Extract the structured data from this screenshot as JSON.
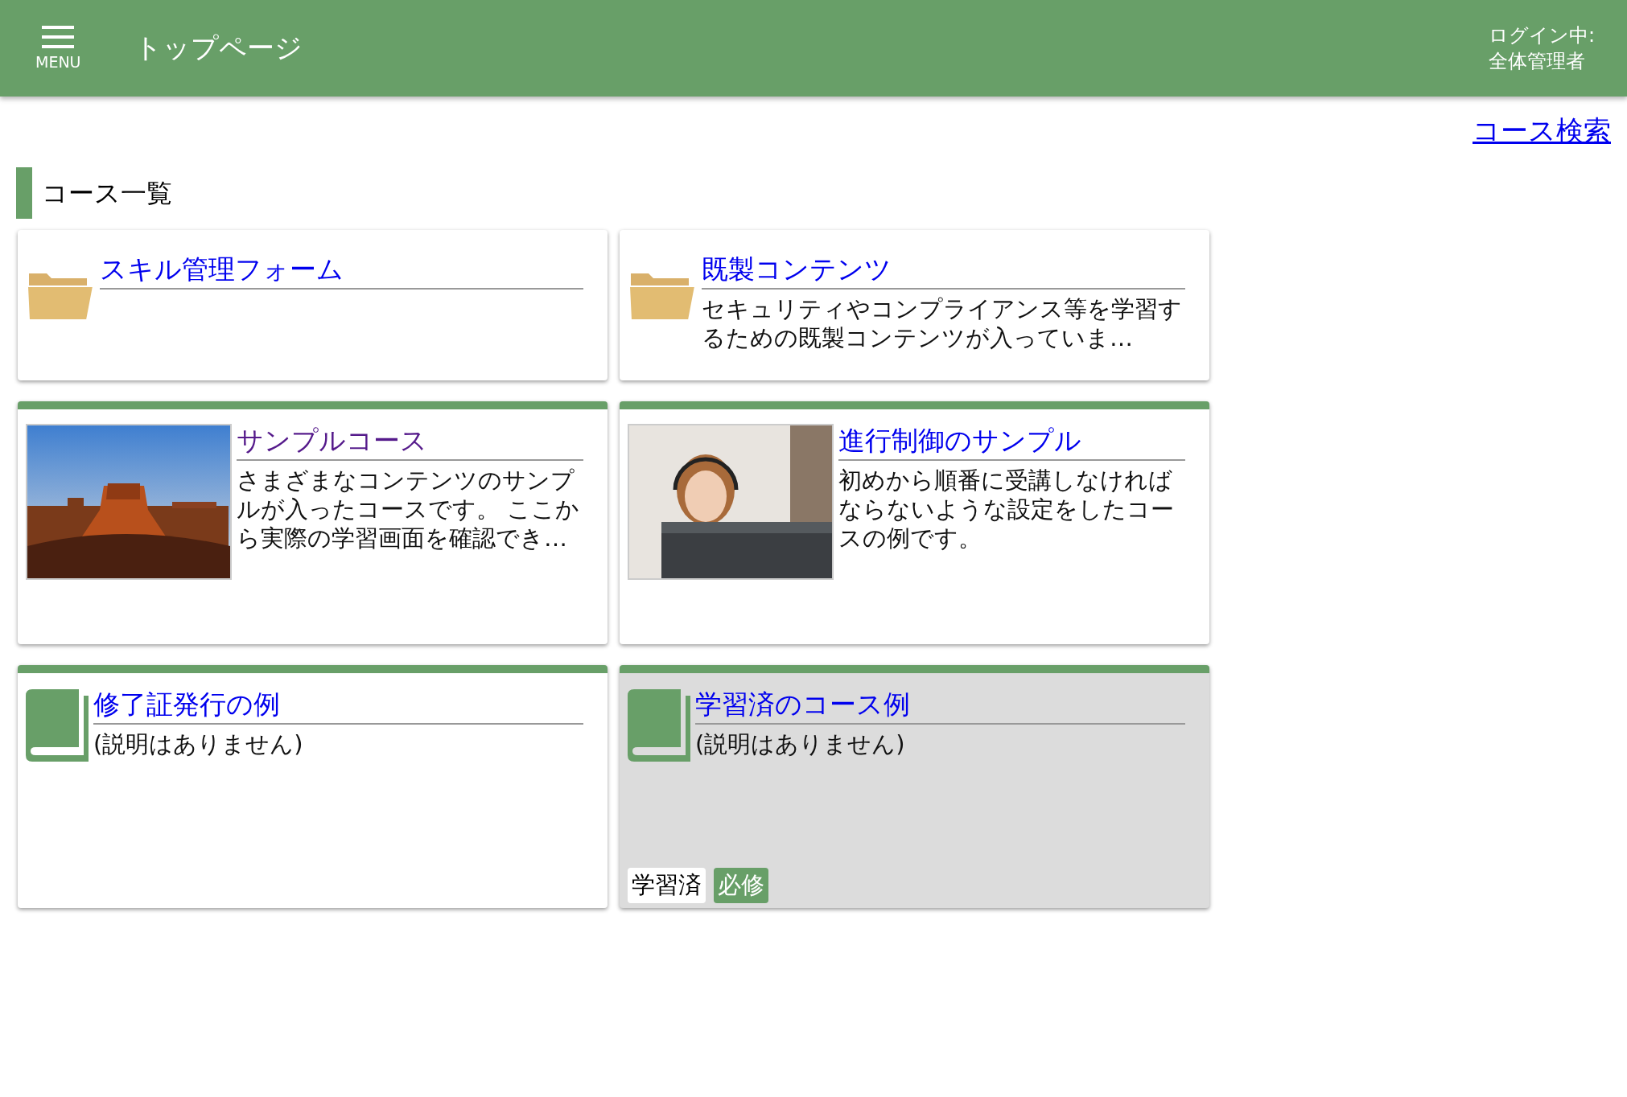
{
  "header": {
    "menu_label": "MENU",
    "title": "トップページ",
    "login_label": "ログイン中:",
    "user": "全体管理者"
  },
  "search_link": "コース検索",
  "section_title": "コース一覧",
  "courses": [
    {
      "kind": "folder",
      "title": "スキル管理フォーム",
      "visited": false,
      "completed": false
    },
    {
      "kind": "folder",
      "title": "既製コンテンツ",
      "description": "セキュリティやコンプライアンス等を学習するための既製コンテンツが入っていま…",
      "visited": false,
      "completed": false
    },
    {
      "kind": "course",
      "title": "サンプルコース",
      "description": "さまざまなコンテンツのサンプルが入ったコースです。 ここから実際の学習画面を確認でき…",
      "visited": true,
      "completed": false
    },
    {
      "kind": "course",
      "title": "進行制御のサンプル",
      "description": "初めから順番に受講しなければならないような設定をしたコースの例です。",
      "visited": false,
      "completed": false
    },
    {
      "kind": "book",
      "title": "修了証発行の例",
      "description": "(説明はありません)",
      "visited": false,
      "completed": false
    },
    {
      "kind": "book",
      "title": "学習済のコース例",
      "description": "(説明はありません)",
      "visited": false,
      "completed": true,
      "tags": [
        {
          "label": "学習済",
          "kind": "status"
        },
        {
          "label": "必修",
          "kind": "required"
        }
      ]
    }
  ]
}
